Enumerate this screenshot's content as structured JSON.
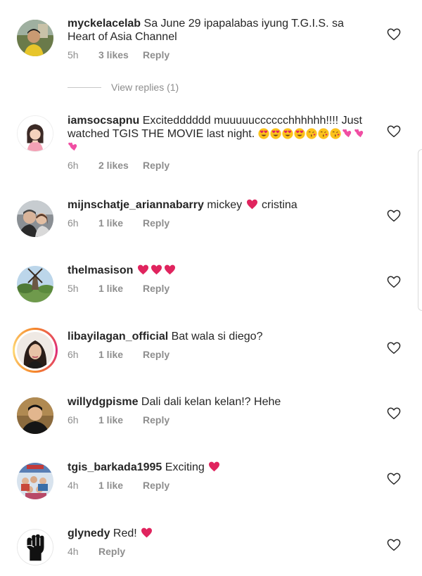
{
  "comments": [
    {
      "username": "myckelacelab",
      "text": "Sa June 29 ipapalabas iyung T.G.I.S. sa Heart of Asia Channel",
      "time": "5h",
      "likes": "3 likes",
      "reply": "Reply",
      "avatar_icon": "avatar-man-photo"
    },
    {
      "username": "iamsocsapnu",
      "text": "Excitedddddd muuuuucccccchhhhhh!!!! Just watched TGIS THE MOVIE last night.",
      "emojis": [
        "heart-eyes",
        "heart-eyes",
        "heart-eyes",
        "heart-eyes",
        "kissing-face",
        "kissing-face",
        "kissing-face",
        "two-hearts",
        "two-hearts",
        "two-hearts"
      ],
      "time": "6h",
      "likes": "2 likes",
      "reply": "Reply",
      "avatar_icon": "avatar-girl-illustration"
    },
    {
      "username": "mijnschatje_ariannabarry",
      "text_before": "mickey",
      "text_after": "cristina",
      "time": "6h",
      "likes": "1 like",
      "reply": "Reply",
      "avatar_icon": "avatar-couple-photo"
    },
    {
      "username": "thelmasison",
      "time": "5h",
      "likes": "1 like",
      "reply": "Reply",
      "avatar_icon": "avatar-windmill-photo"
    },
    {
      "username": "libayilagan_official",
      "text": "Bat wala si diego?",
      "time": "6h",
      "likes": "1 like",
      "reply": "Reply",
      "avatar_icon": "avatar-woman-photo"
    },
    {
      "username": "willydgpisme",
      "text": "Dali dali kelan kelan!? Hehe",
      "time": "6h",
      "likes": "1 like",
      "reply": "Reply",
      "avatar_icon": "avatar-man-photo"
    },
    {
      "username": "tgis_barkada1995",
      "text": "Exciting",
      "time": "4h",
      "likes": "1 like",
      "reply": "Reply",
      "avatar_icon": "avatar-group-photo"
    },
    {
      "username": "glynedy",
      "text": "Red!",
      "time": "4h",
      "reply": "Reply",
      "avatar_icon": "avatar-raised-fist"
    }
  ],
  "view_replies": "View replies (1)",
  "colors": {
    "text": "#262626",
    "secondary": "#8e8e8e",
    "heart_emoji": "#e0245e",
    "story_ring": "#dd2a7b"
  }
}
